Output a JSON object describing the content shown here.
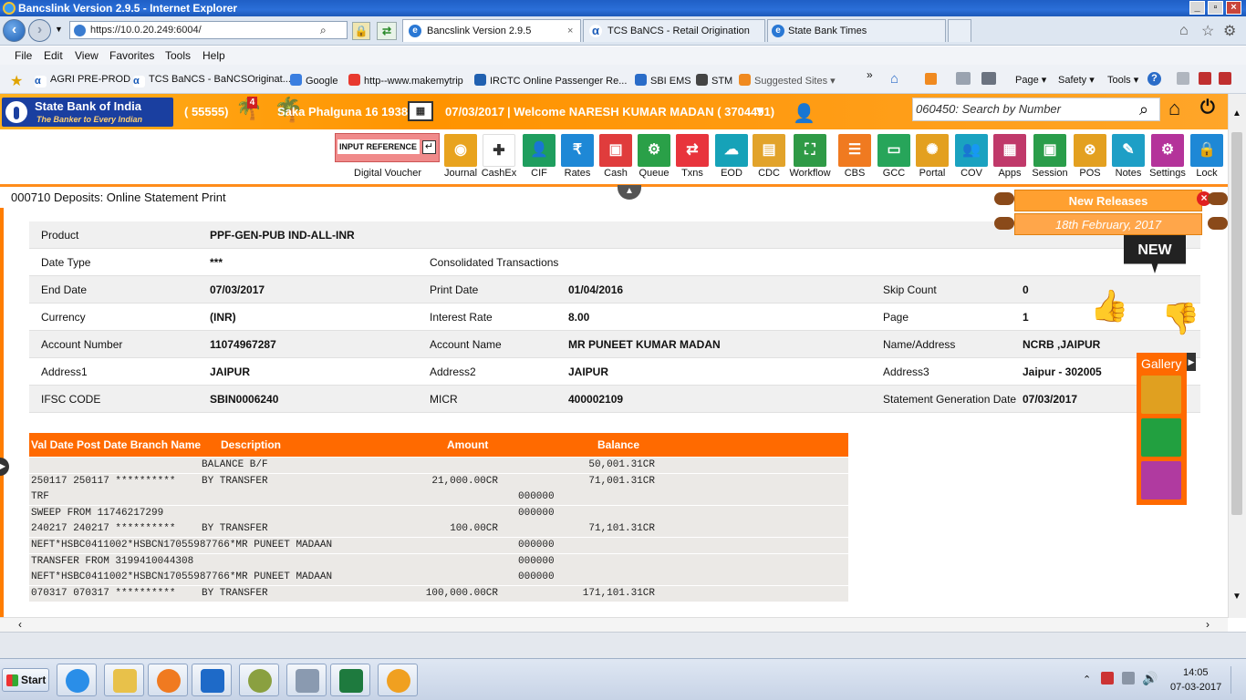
{
  "window": {
    "title": "Bancslink Version 2.9.5 - Internet Explorer"
  },
  "browser": {
    "url": "https://10.0.20.249:6004/",
    "tabs": [
      {
        "label": "Bancslink Version 2.9.5",
        "close": "×"
      },
      {
        "label": "TCS BaNCS - Retail Origination"
      },
      {
        "label": "State Bank Times"
      }
    ],
    "menu": [
      "File",
      "Edit",
      "View",
      "Favorites",
      "Tools",
      "Help"
    ],
    "favorites": [
      "AGRI PRE-PROD",
      "TCS BaNCS - BaNCSOriginat...",
      "Google",
      "http--www.makemytrip",
      "IRCTC Online Passenger Re...",
      "SBI EMS",
      "STM",
      "Suggested Sites ▾"
    ],
    "command": [
      "Page ▾",
      "Safety ▾",
      "Tools ▾"
    ]
  },
  "header": {
    "bank_name": "State Bank of India",
    "tagline": "The Banker to Every Indian",
    "branch": "( 55555)",
    "badge": "4",
    "saka_date": "Saka Phalguna 16 1938",
    "date": "07/03/2017",
    "welcome": "| Welcome NARESH KUMAR MADAN ( 3704491)",
    "search_placeholder": "060450: Search by Number"
  },
  "toolbar": {
    "input_reference": "INPUT REFERENCE",
    "digital_voucher": "Digital Voucher",
    "items": [
      {
        "label": "Journal",
        "color": "#e8a31e"
      },
      {
        "label": "CashEx",
        "color": "#ffffff"
      },
      {
        "label": "CIF",
        "color": "#1f9e5e"
      },
      {
        "label": "Rates",
        "color": "#1e88d6"
      },
      {
        "label": "Cash",
        "color": "#e03c3c"
      },
      {
        "label": "Queue",
        "color": "#2aa048"
      },
      {
        "label": "Txns",
        "color": "#e8343c"
      },
      {
        "label": "EOD",
        "color": "#16a2b8"
      },
      {
        "label": "CDC",
        "color": "#e2a32a"
      },
      {
        "label": "Workflow",
        "color": "#2f9a46"
      },
      {
        "label": "CBS",
        "color": "#f07a20"
      },
      {
        "label": "GCC",
        "color": "#27a55a"
      },
      {
        "label": "Portal",
        "color": "#e3a020"
      },
      {
        "label": "COV",
        "color": "#1aa2c0"
      },
      {
        "label": "Apps",
        "color": "#c0396a"
      },
      {
        "label": "Session",
        "color": "#2a9d4a"
      },
      {
        "label": "POS",
        "color": "#e3a020"
      },
      {
        "label": "Notes",
        "color": "#1e9fc6"
      },
      {
        "label": "Settings",
        "color": "#b4339a"
      },
      {
        "label": "Lock",
        "color": "#1e88d6"
      }
    ]
  },
  "page": {
    "title": "000710 Deposits: Online Statement Print"
  },
  "details": [
    [
      {
        "label": "Product",
        "value": "PPF-GEN-PUB IND-ALL-INR"
      }
    ],
    [
      {
        "label": "Date Type",
        "value": "***"
      },
      {
        "label": "Consolidated Transactions",
        "value": ""
      }
    ],
    [
      {
        "label": "End Date",
        "value": "07/03/2017"
      },
      {
        "label": "Print Date",
        "value": "01/04/2016"
      },
      {
        "label": "Skip Count",
        "value": "0"
      }
    ],
    [
      {
        "label": "Currency",
        "value": "(INR)"
      },
      {
        "label": "Interest Rate",
        "value": " 8.00"
      },
      {
        "label": "Page",
        "value": "1"
      }
    ],
    [
      {
        "label": "Account Number",
        "value": "11074967287"
      },
      {
        "label": "Account Name",
        "value": "MR PUNEET KUMAR MADAN"
      },
      {
        "label": "Name/Address",
        "value": "NCRB ,JAIPUR"
      }
    ],
    [
      {
        "label": "Address1",
        "value": "JAIPUR"
      },
      {
        "label": "Address2",
        "value": "JAIPUR"
      },
      {
        "label": "Address3",
        "value": "Jaipur - 302005"
      }
    ],
    [
      {
        "label": "IFSC CODE",
        "value": "SBIN0006240"
      },
      {
        "label": "MICR",
        "value": "400002109"
      },
      {
        "label": "Statement Generation Date",
        "value": "07/03/2017"
      }
    ]
  ],
  "transactions": {
    "headers": [
      "Val Date Post Date Branch Name",
      "Description",
      "Amount",
      "Balance"
    ],
    "rows": [
      [
        "",
        "BALANCE B/F",
        "",
        "",
        "50,001.31CR"
      ],
      [
        "250117 250117 **********",
        "BY TRANSFER",
        "21,000.00CR",
        "",
        "71,001.31CR"
      ],
      [
        "TRF",
        "",
        "",
        "000000",
        ""
      ],
      [
        "SWEEP FROM 11746217299",
        "",
        "",
        "000000",
        ""
      ],
      [
        "240217 240217 **********",
        "BY TRANSFER",
        "100.00CR",
        "",
        "71,101.31CR"
      ],
      [
        "NEFT*HSBC0411002*HSBCN17055987766*MR PUNEET MADAAN",
        "",
        "",
        "000000",
        ""
      ],
      [
        "TRANSFER FROM 3199410044308",
        "",
        "",
        "000000",
        ""
      ],
      [
        "NEFT*HSBC0411002*HSBCN17055987766*MR PUNEET MADAAN",
        "",
        "",
        "000000",
        ""
      ],
      [
        "070317 070317 **********",
        "BY TRANSFER",
        "100,000.00CR",
        "",
        "171,101.31CR"
      ]
    ]
  },
  "release": {
    "title": "New Releases",
    "date": "18th February, 2017",
    "badge": "NEW"
  },
  "gallery": {
    "label": "Gallery"
  },
  "taskbar": {
    "start": "Start",
    "time": "14:05",
    "date": "07-03-2017"
  }
}
